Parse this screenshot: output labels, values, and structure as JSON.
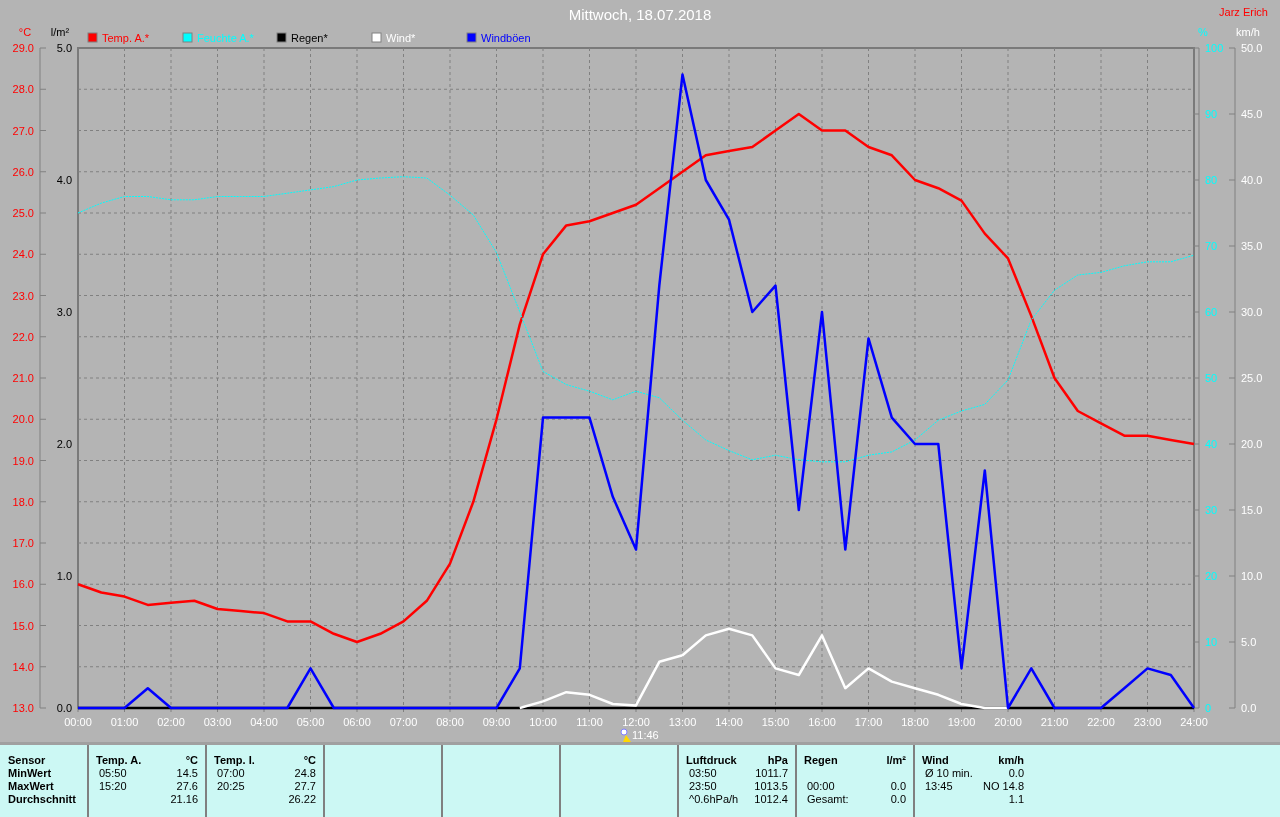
{
  "window": {
    "title": "Mittwoch, 18.07.2018",
    "author": "Jarz Erich"
  },
  "chart": {
    "marker": {
      "label": "11:46"
    },
    "rain_axis": {
      "unit": "l/m²",
      "color": "#000000",
      "ticks": [
        "5.0",
        "4.0",
        "3.0",
        "2.0",
        "1.0",
        "0.0"
      ]
    },
    "chart_data": {
      "type": "line",
      "grid": true,
      "legend": "top",
      "xlim": [
        0,
        24
      ],
      "x": [
        0,
        0.5,
        1,
        1.5,
        2,
        2.5,
        3,
        3.5,
        4,
        4.5,
        5,
        5.5,
        6,
        6.5,
        7,
        7.5,
        8,
        8.5,
        9,
        9.5,
        10,
        10.5,
        11,
        11.5,
        12,
        12.5,
        13,
        13.5,
        14,
        14.5,
        15,
        15.5,
        16,
        16.5,
        17,
        17.5,
        18,
        18.5,
        19,
        19.5,
        20,
        20.5,
        21,
        21.5,
        22,
        22.5,
        23,
        23.5,
        24
      ],
      "xticks": [
        {
          "value": 0,
          "label": "00:00"
        },
        {
          "value": 1,
          "label": "01:00"
        },
        {
          "value": 2,
          "label": "02:00"
        },
        {
          "value": 3,
          "label": "03:00"
        },
        {
          "value": 4,
          "label": "04:00"
        },
        {
          "value": 5,
          "label": "05:00"
        },
        {
          "value": 6,
          "label": "06:00"
        },
        {
          "value": 7,
          "label": "07:00"
        },
        {
          "value": 8,
          "label": "08:00"
        },
        {
          "value": 9,
          "label": "09:00"
        },
        {
          "value": 10,
          "label": "10:00"
        },
        {
          "value": 11,
          "label": "11:00"
        },
        {
          "value": 12,
          "label": "12:00"
        },
        {
          "value": 13,
          "label": "13:00"
        },
        {
          "value": 14,
          "label": "14:00"
        },
        {
          "value": 15,
          "label": "15:00"
        },
        {
          "value": 16,
          "label": "16:00"
        },
        {
          "value": 17,
          "label": "17:00"
        },
        {
          "value": 18,
          "label": "18:00"
        },
        {
          "value": 19,
          "label": "19:00"
        },
        {
          "value": 20,
          "label": "20:00"
        },
        {
          "value": 21,
          "label": "21:00"
        },
        {
          "value": 22,
          "label": "22:00"
        },
        {
          "value": 23,
          "label": "23:00"
        },
        {
          "value": 24,
          "label": "24:00"
        }
      ],
      "ylabel": "°C",
      "ylim": [
        13,
        29
      ],
      "y2label": "%",
      "y2lim": [
        0,
        100
      ],
      "y2ticks": [
        {
          "value": 0,
          "label": "0"
        },
        {
          "value": 10,
          "label": "10"
        },
        {
          "value": 20,
          "label": "20"
        },
        {
          "value": 30,
          "label": "30"
        },
        {
          "value": 40,
          "label": "40"
        },
        {
          "value": 50,
          "label": "50"
        },
        {
          "value": 60,
          "label": "60"
        },
        {
          "value": 70,
          "label": "70"
        },
        {
          "value": 80,
          "label": "80"
        },
        {
          "value": 90,
          "label": "90"
        },
        {
          "value": 100,
          "label": "100"
        }
      ],
      "y3label": "km/h",
      "y3lim": [
        0,
        50
      ],
      "y3ticks": [
        {
          "value": 0,
          "label": "0.0"
        },
        {
          "value": 5,
          "label": "5.0"
        },
        {
          "value": 10,
          "label": "10.0"
        },
        {
          "value": 15,
          "label": "15.0"
        },
        {
          "value": 20,
          "label": "20.0"
        },
        {
          "value": 25,
          "label": "25.0"
        },
        {
          "value": 30,
          "label": "30.0"
        },
        {
          "value": 35,
          "label": "35.0"
        },
        {
          "value": 40,
          "label": "40.0"
        },
        {
          "value": 45,
          "label": "45.0"
        },
        {
          "value": 50,
          "label": "50.0"
        }
      ],
      "yticks": [
        {
          "value": 13,
          "label": "13.0"
        },
        {
          "value": 14,
          "label": "14.0"
        },
        {
          "value": 15,
          "label": "15.0"
        },
        {
          "value": 16,
          "label": "16.0"
        },
        {
          "value": 17,
          "label": "17.0"
        },
        {
          "value": 18,
          "label": "18.0"
        },
        {
          "value": 19,
          "label": "19.0"
        },
        {
          "value": 20,
          "label": "20.0"
        },
        {
          "value": 21,
          "label": "21.0"
        },
        {
          "value": 22,
          "label": "22.0"
        },
        {
          "value": 23,
          "label": "23.0"
        },
        {
          "value": 24,
          "label": "24.0"
        },
        {
          "value": 25,
          "label": "25.0"
        },
        {
          "value": 26,
          "label": "26.0"
        },
        {
          "value": 27,
          "label": "27.0"
        },
        {
          "value": 28,
          "label": "28.0"
        },
        {
          "value": 29,
          "label": "29.0"
        }
      ],
      "series": [
        {
          "name": "Temp. A.*",
          "color": "#ff0000",
          "values": [
            16.0,
            15.8,
            15.7,
            15.5,
            15.55,
            15.6,
            15.4,
            15.35,
            15.3,
            15.1,
            15.1,
            14.8,
            14.6,
            14.8,
            15.1,
            15.6,
            16.5,
            18.0,
            20.0,
            22.3,
            24.0,
            24.7,
            24.8,
            25.0,
            25.2,
            25.6,
            26.0,
            26.4,
            26.5,
            26.6,
            27.0,
            27.4,
            27.0,
            27.0,
            26.6,
            26.4,
            25.8,
            25.6,
            25.3,
            24.5,
            23.9,
            22.5,
            21.0,
            20.2,
            19.9,
            19.6,
            19.6,
            19.5,
            19.4
          ]
        },
        {
          "name": "Feuchte A.*",
          "color": "#00ffff",
          "line_style": "dashed",
          "axis": "y2",
          "values": [
            75,
            76.5,
            77.5,
            77.5,
            77,
            77,
            77.5,
            77.5,
            77.5,
            78,
            78.5,
            79,
            80,
            80.3,
            80.5,
            80.3,
            77.7,
            74.7,
            69,
            60,
            51,
            49,
            48,
            46.7,
            48,
            47,
            43.6,
            40.6,
            39,
            37.6,
            38.3,
            37.6,
            37.3,
            37.3,
            38.3,
            38.8,
            40.6,
            43.6,
            45,
            46,
            49.7,
            58.8,
            63.3,
            65.6,
            66,
            67,
            67.6,
            67.6,
            68.6
          ]
        },
        {
          "name": "Regen*",
          "color": "#000000",
          "axis": "y3",
          "values": [
            0,
            0,
            0,
            0,
            0,
            0,
            0,
            0,
            0,
            0,
            0,
            0,
            0,
            0,
            0,
            0,
            0,
            0,
            0,
            0,
            0,
            0,
            0,
            0,
            0,
            0,
            0,
            0,
            0,
            0,
            0,
            0,
            0,
            0,
            0,
            0,
            0,
            0,
            0,
            0,
            0,
            0,
            0,
            0,
            0,
            0,
            0,
            0,
            0
          ]
        },
        {
          "name": "Wind*",
          "color": "#ffffff",
          "axis": "y3",
          "values": [
            null,
            null,
            null,
            null,
            null,
            null,
            null,
            null,
            null,
            null,
            null,
            null,
            null,
            null,
            null,
            null,
            null,
            null,
            null,
            0,
            0.5,
            1.2,
            1.0,
            0.3,
            0.2,
            3.5,
            4.0,
            5.5,
            6.0,
            5.5,
            3.0,
            2.5,
            5.5,
            1.5,
            3.0,
            2.0,
            1.5,
            1.0,
            0.3,
            0,
            0,
            null,
            null,
            null,
            null,
            null,
            null,
            null,
            null
          ]
        },
        {
          "name": "Windböen",
          "color": "#0000ff",
          "axis": "y3",
          "values": [
            0,
            0,
            0,
            1.5,
            0,
            0,
            0,
            0,
            0,
            0,
            3,
            0,
            0,
            0,
            0,
            0,
            0,
            0,
            0,
            3,
            22,
            22,
            22,
            16,
            12,
            32,
            48,
            40,
            37,
            30,
            32,
            15,
            30,
            12,
            28,
            22,
            20,
            20,
            3,
            18,
            0,
            3,
            0,
            0,
            0,
            1.5,
            3,
            2.5,
            0
          ]
        }
      ]
    }
  },
  "stats": {
    "row_labels": [
      "Sensor",
      "MinWert",
      "MaxWert",
      "Durchschnitt"
    ],
    "groups": [
      {
        "kind": "data",
        "title": "Temp. A.",
        "unit": "°C",
        "rows": [
          {
            "label": "05:50",
            "value": "14.5"
          },
          {
            "label": "15:20",
            "value": "27.6"
          },
          {
            "value": "21.16"
          }
        ]
      },
      {
        "kind": "data",
        "title": "Temp. I.",
        "unit": "°C",
        "rows": [
          {
            "label": "07:00",
            "value": "24.8"
          },
          {
            "label": "20:25",
            "value": "27.7"
          },
          {
            "value": "26.22"
          }
        ]
      },
      {
        "kind": "empty"
      },
      {
        "kind": "empty"
      },
      {
        "kind": "empty"
      },
      {
        "kind": "data",
        "title": "Luftdruck",
        "unit": "hPa",
        "rows": [
          {
            "label": "03:50",
            "value": "1011.7"
          },
          {
            "label": "23:50",
            "value": "1013.5"
          },
          {
            "label": "^0.6hPa/h",
            "value": "1012.4"
          }
        ]
      },
      {
        "kind": "data",
        "title": "Regen",
        "unit": "l/m²",
        "rows": [
          {},
          {
            "label": "00:00",
            "value": "0.0"
          },
          {
            "label": "Gesamt:",
            "value": "0.0"
          }
        ]
      },
      {
        "kind": "data",
        "title": "Wind",
        "unit": "km/h",
        "rows": [
          {
            "label": "Ø 10 min.",
            "value": "0.0"
          },
          {
            "label": "13:45",
            "value": "NO 14.8"
          },
          {
            "value": "1.1"
          }
        ]
      }
    ]
  }
}
